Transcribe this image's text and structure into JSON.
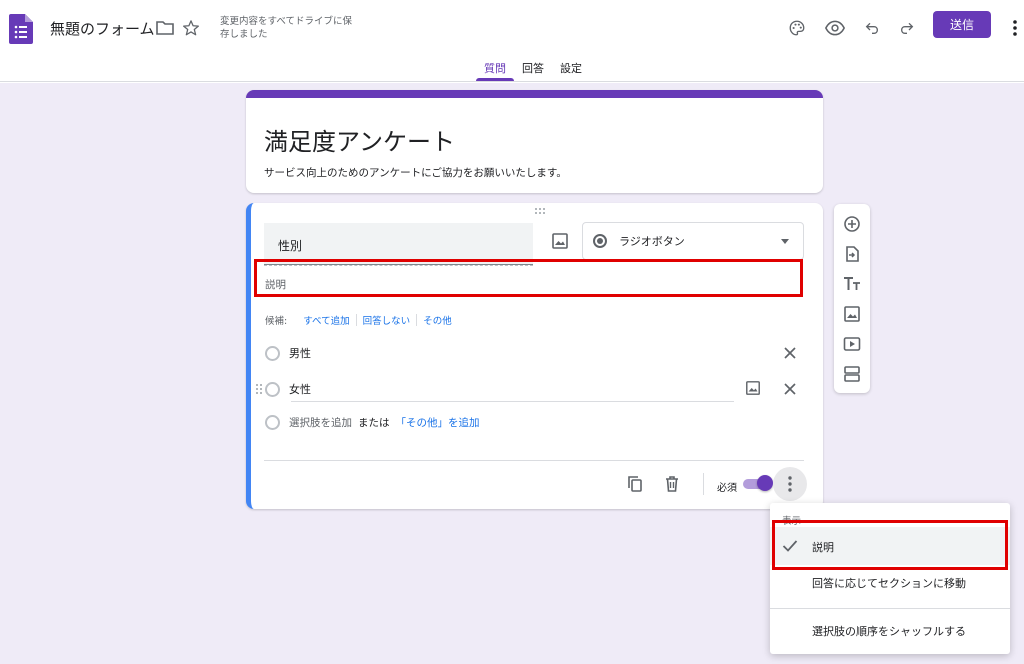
{
  "header": {
    "doc_title": "無題のフォーム",
    "save_status": "変更内容をすべてドライブに保存しました",
    "send_label": "送信",
    "tabs": [
      {
        "label": "質問",
        "active": true
      },
      {
        "label": "回答",
        "active": false
      },
      {
        "label": "設定",
        "active": false
      }
    ]
  },
  "form": {
    "title": "満足度アンケート",
    "description": "サービス向上のためのアンケートにご協力をお願いいたします。"
  },
  "question": {
    "title": "性別",
    "type_label": "ラジオボタン",
    "description_placeholder": "説明",
    "suggestions_label": "候補:",
    "suggestions": [
      "すべて追加",
      "回答しない",
      "その他"
    ],
    "options": [
      "男性",
      "女性"
    ],
    "add_option": "選択肢を追加",
    "add_or": "または",
    "add_other": "「その他」を追加",
    "required_label": "必須",
    "required": true
  },
  "menu": {
    "header": "表示",
    "items": [
      {
        "label": "説明",
        "checked": true
      },
      {
        "label": "回答に応じてセクションに移動",
        "checked": false
      },
      {
        "label": "選択肢の順序をシャッフルする",
        "checked": false
      }
    ]
  },
  "colors": {
    "accent": "#673ab7",
    "link": "#1a73e8",
    "highlight": "#e00000",
    "canvas": "#efebf7"
  }
}
